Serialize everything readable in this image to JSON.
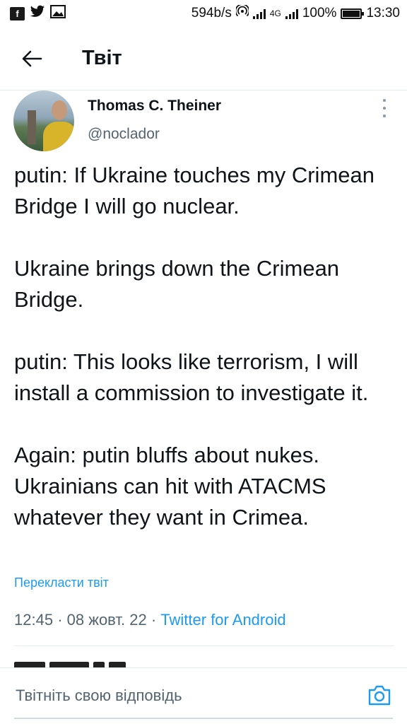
{
  "status_bar": {
    "speed": "594b/s",
    "network": "4G",
    "battery": "100%",
    "time": "13:30"
  },
  "header": {
    "title": "Твіт"
  },
  "tweet": {
    "author_name": "Thomas C. Theiner",
    "author_handle": "@noclador",
    "paragraphs": [
      "putin: If Ukraine touches my Crimean Bridge I will go nuclear.",
      "Ukraine brings down the Crimean Bridge.",
      "putin: This looks like terrorism, I will install a commission to investigate it.",
      "Again: putin bluffs about nukes. Ukrainians can hit with ATACMS whatever they want in Crimea."
    ],
    "translate_label": "Перекласти твіт",
    "time": "12:45",
    "date": "08 жовт. 22",
    "source": "Twitter for Android"
  },
  "reply": {
    "placeholder": "Твітніть свою відповідь"
  },
  "colors": {
    "accent": "#1d9bf0",
    "muted": "#536471",
    "text": "#0f1419"
  }
}
